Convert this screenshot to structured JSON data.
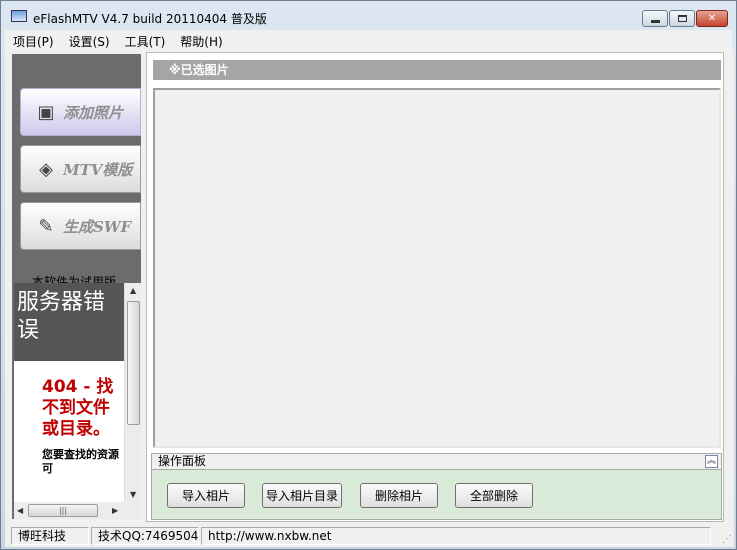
{
  "window": {
    "title": "eFlashMTV V4.7 build 20110404 普及版"
  },
  "menu": [
    {
      "label": "项目(P)"
    },
    {
      "label": "设置(S)"
    },
    {
      "label": "工具(T)"
    },
    {
      "label": "帮助(H)"
    }
  ],
  "nav": [
    {
      "label": "添加照片",
      "icon": "photo-icon",
      "active": true
    },
    {
      "label": "MTV模版",
      "icon": "cube-icon",
      "active": false
    },
    {
      "label": "生成SWF",
      "icon": "pen-icon",
      "active": false
    }
  ],
  "trial_text": "本软件为试用版",
  "browser": {
    "header": "服务器错误",
    "error_title": "404 - 找不到文件或目录。",
    "error_desc": "您要查找的资源可"
  },
  "photos": {
    "header": "※已选图片"
  },
  "ops": {
    "title": "操作面板",
    "buttons": [
      {
        "label": "导入相片"
      },
      {
        "label": "导入相片目录"
      },
      {
        "label": "删除相片"
      },
      {
        "label": "全部删除"
      }
    ]
  },
  "status": [
    {
      "label": "博旺科技"
    },
    {
      "label": "技术QQ:7469504"
    },
    {
      "label": "http://www.nxbw.net"
    }
  ]
}
